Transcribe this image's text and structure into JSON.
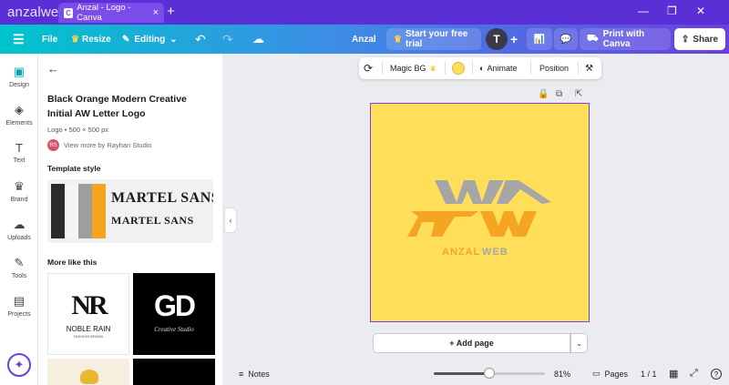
{
  "browser": {
    "brand": "anzalweb",
    "tab_title": "Anzal - Logo - Canva",
    "tab_favicon": "C",
    "new_tab": "+",
    "minimize": "—",
    "restore": "❐",
    "close": "✕"
  },
  "topbar": {
    "menu_icon": "☰",
    "file": "File",
    "resize": "Resize",
    "editing": "Editing",
    "undo": "↶",
    "redo": "↷",
    "cloud_icon": "☁",
    "doc_name": "Anzal",
    "trial": "Start your free trial",
    "avatar": "T",
    "add": "+",
    "print": "Print with Canva",
    "share": "Share"
  },
  "rail": [
    {
      "label": "Design",
      "icon": "▣"
    },
    {
      "label": "Elements",
      "icon": "◈"
    },
    {
      "label": "Text",
      "icon": "T"
    },
    {
      "label": "Brand",
      "icon": "♛"
    },
    {
      "label": "Uploads",
      "icon": "☁"
    },
    {
      "label": "Tools",
      "icon": "✎"
    },
    {
      "label": "Projects",
      "icon": "▤"
    }
  ],
  "panel": {
    "back": "←",
    "title": "Black Orange Modern Creative Initial AW Letter Logo",
    "meta": "Logo • 500 × 500 px",
    "author_initials": "RS",
    "author": "View more by Rayhan Studio",
    "template_style": "Template style",
    "font_name_1": "MARTEL SANS",
    "font_name_2": "MARTEL SANS",
    "more_like_this": "More like this",
    "thumb1_title": "NR",
    "thumb1_name": "NOBLE RAIN",
    "thumb1_sub": "FASHION BRAND",
    "thumb2_title": "GD",
    "thumb2_sub": "Creative Studio"
  },
  "swatches": [
    "#2b2b2b",
    "#f5f5f5",
    "#9e9e9e",
    "#f6a523"
  ],
  "context": {
    "rotate_icon": "⟳",
    "magic_bg": "Magic BG",
    "crown": "♛",
    "color": "#ffde59",
    "animate": "Animate",
    "position": "Position",
    "paint_icon": "🖌"
  },
  "canvas": {
    "bg": "#ffde59",
    "logo_text": "AW",
    "brand_a": "ANZAL",
    "brand_b": "WEB",
    "gray": "#a6a6a6",
    "orange": "#f6a523"
  },
  "addpage": {
    "label": "+ Add page",
    "more": "⌄"
  },
  "bottom": {
    "notes": "Notes",
    "zoom": "81%",
    "zoom_fraction": 0.5,
    "pages": "Pages",
    "page_count": "1 / 1",
    "grid_icon": "▦",
    "fullscreen_icon": "⤢",
    "help_icon": "?"
  }
}
